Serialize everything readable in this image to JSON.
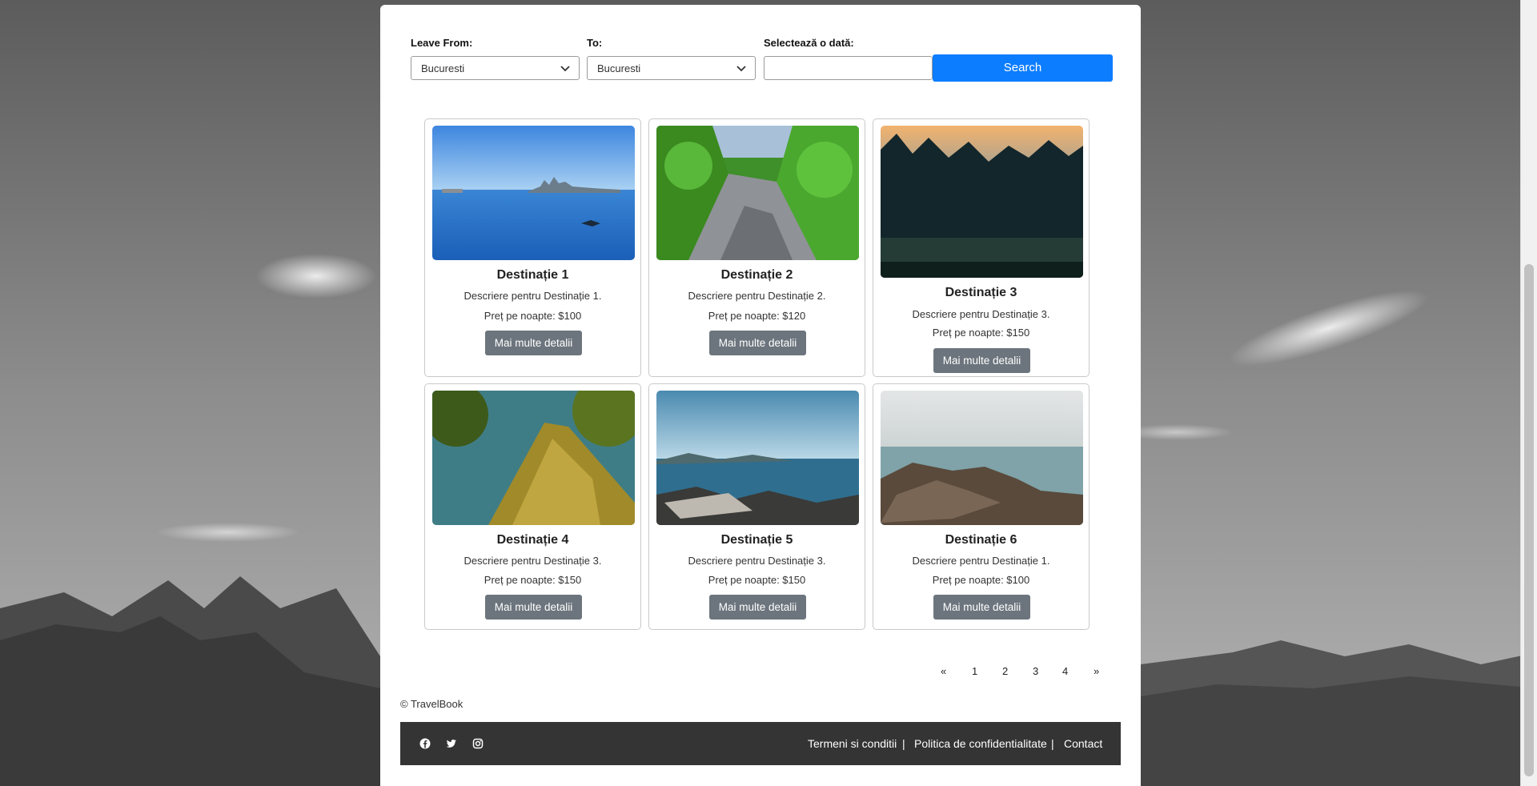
{
  "search_form": {
    "leave_from_label": "Leave From:",
    "leave_from_value": "Bucuresti",
    "to_label": "To:",
    "to_value": "Bucuresti",
    "date_label": "Selectează o dată:",
    "date_value": "",
    "search_label": "Search"
  },
  "cards": [
    {
      "title": "Destinație 1",
      "description": "Descriere pentru Destinație 1.",
      "price": "Preț pe noapte: $100",
      "button": "Mai multe detalii",
      "image": "bay-city-skyline-photo"
    },
    {
      "title": "Destinație 2",
      "description": "Descriere pentru Destinație 2.",
      "price": "Preț pe noapte: $120",
      "button": "Mai multe detalii",
      "image": "forest-river-photo"
    },
    {
      "title": "Destinație 3",
      "description": "Descriere pentru Destinație 3.",
      "price": "Preț pe noapte: $150",
      "button": "Mai multe detalii",
      "image": "dark-forest-sunset-photo"
    },
    {
      "title": "Destinație 4",
      "description": "Descriere pentru Destinație 3.",
      "price": "Preț pe noapte: $150",
      "button": "Mai multe detalii",
      "image": "mossy-tree-photo"
    },
    {
      "title": "Destinație 5",
      "description": "Descriere pentru Destinație 3.",
      "price": "Preț pe noapte: $150",
      "button": "Mai multe detalii",
      "image": "rocky-lake-shore-photo"
    },
    {
      "title": "Destinație 6",
      "description": "Descriere pentru Destinație 1.",
      "price": "Preț pe noapte: $100",
      "button": "Mai multe detalii",
      "image": "rocky-sea-coast-photo"
    }
  ],
  "pagination": {
    "prev": "«",
    "pages": [
      "1",
      "2",
      "3",
      "4"
    ],
    "next": "»"
  },
  "copyright": "© TravelBook",
  "footer": {
    "social": [
      "facebook-icon",
      "twitter-icon",
      "instagram-icon"
    ],
    "links": [
      "Termeni si conditii",
      "Politica de confidentialitate",
      "Contact"
    ],
    "separator": "|"
  },
  "colors": {
    "primary": "#0d7dff",
    "secondary": "#6c757d",
    "footer_bg": "#343434"
  }
}
